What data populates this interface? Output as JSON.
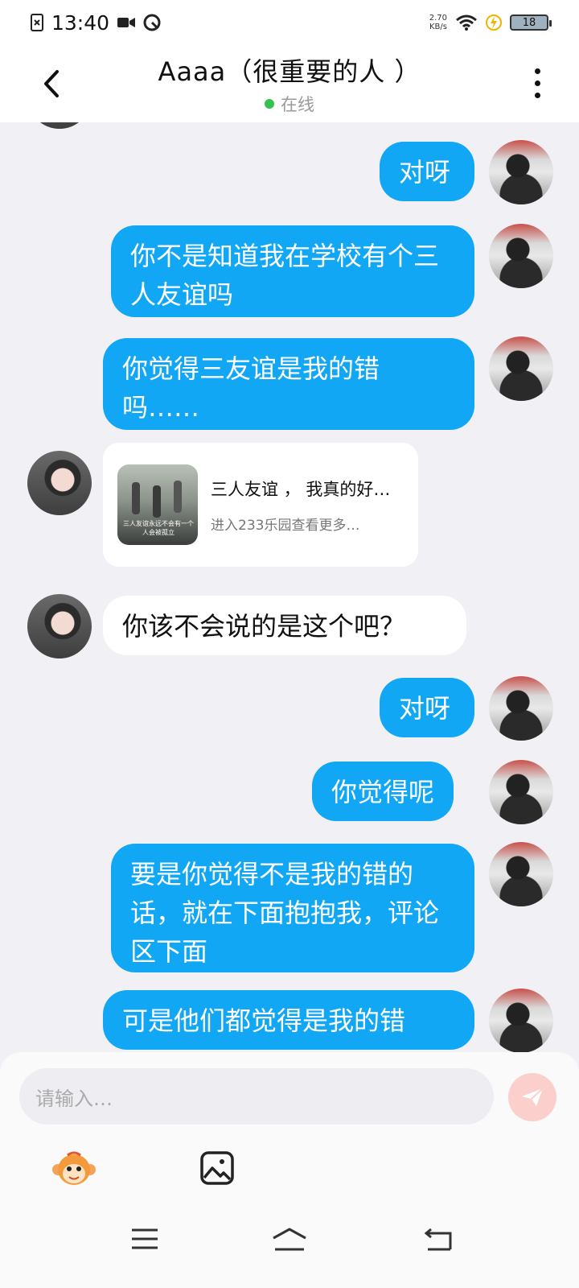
{
  "status_bar": {
    "time": "13:40",
    "net_speed_value": "2.70",
    "net_speed_unit": "KB/s",
    "battery": "18"
  },
  "header": {
    "title": "Aaaa（很重要的人 ）",
    "status": "在线",
    "status_color": "#33c24d"
  },
  "messages": [
    {
      "from": "me",
      "text": "对呀"
    },
    {
      "from": "me",
      "text": "你不是知道我在学校有个三人友谊吗"
    },
    {
      "from": "me",
      "text": "你觉得三友谊是我的错吗……"
    },
    {
      "from": "other",
      "type": "card",
      "title": "三人友谊 ， 我真的好…",
      "subtitle": "进入233乐园查看更多…",
      "thumb_caption": "三人友谊永远不会有一个人会被孤立"
    },
    {
      "from": "other",
      "text": "你该不会说的是这个吧？"
    },
    {
      "from": "me",
      "text": "对呀"
    },
    {
      "from": "me",
      "text": "你觉得呢"
    },
    {
      "from": "me",
      "text": "要是你觉得不是我的错的话，就在下面抱抱我，评论区下面"
    },
    {
      "from": "me",
      "text": "可是他们都觉得是我的错"
    }
  ],
  "composer": {
    "placeholder": "请输入…",
    "accent": "#12a7f5",
    "send_color": "#f7776a"
  }
}
